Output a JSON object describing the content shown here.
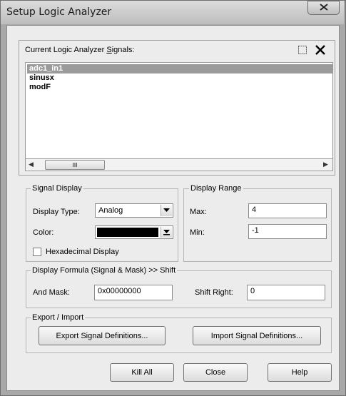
{
  "window": {
    "title": "Setup Logic Analyzer"
  },
  "signals": {
    "label": "Current Logic Analyzer Signals:",
    "items": [
      "adc1_in1",
      "sinusx",
      "modF"
    ],
    "selected_index": 0
  },
  "scrollbar": {
    "thumb_glyph": "III"
  },
  "signal_display": {
    "title": "Signal Display",
    "type_label": "Display Type:",
    "type_value": "Analog",
    "color_label": "Color:",
    "color_value": "#000000",
    "hex_label": "Hexadecimal Display",
    "hex_checked": false
  },
  "display_range": {
    "title": "Display Range",
    "max_label": "Max:",
    "max_value": "4",
    "min_label": "Min:",
    "min_value": "-1"
  },
  "formula": {
    "title": "Display Formula (Signal & Mask) >> Shift",
    "mask_label": "And Mask:",
    "mask_value": "0x00000000",
    "shift_label": "Shift Right:",
    "shift_value": "0"
  },
  "export_import": {
    "title": "Export / Import",
    "export_label": "Export Signal Definitions...",
    "import_label": "Import Signal Definitions..."
  },
  "buttons": {
    "kill_all": "Kill All",
    "close": "Close",
    "help": "Help"
  }
}
